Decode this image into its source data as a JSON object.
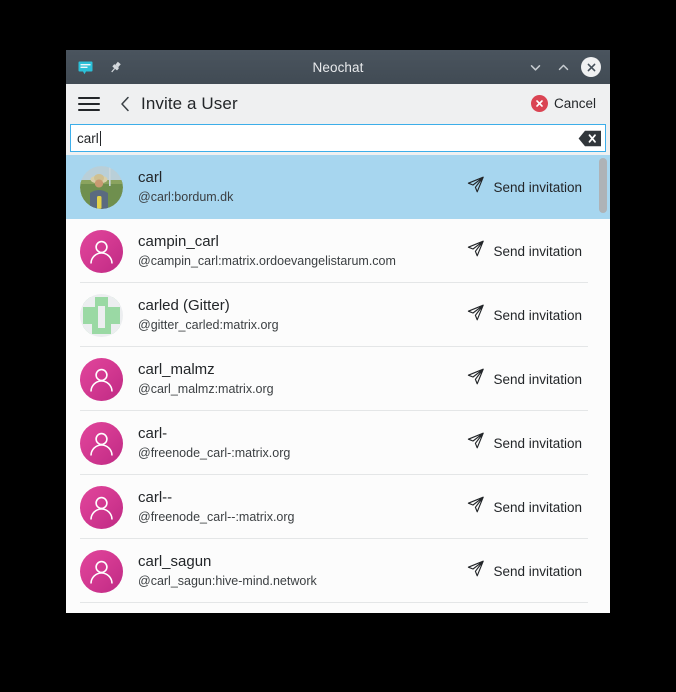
{
  "window": {
    "title": "Neochat",
    "app_icon": "chat-bubble-icon",
    "pin_icon": "pin-icon",
    "minimize_icon": "chevron-down-icon",
    "maximize_icon": "chevron-up-icon",
    "close_icon": "close-icon",
    "accent_color": "#3daee9",
    "titlebar_color": "#45505a"
  },
  "header": {
    "menu_icon": "hamburger-menu-icon",
    "back_icon": "chevron-left-icon",
    "title": "Invite a User",
    "cancel_label": "Cancel",
    "cancel_icon": "cancel-circle-icon",
    "cancel_color": "#da4453"
  },
  "search": {
    "value": "carl",
    "placeholder": "",
    "clear_icon": "clear-text-icon"
  },
  "list": {
    "invite_icon": "send-paper-plane-icon",
    "invite_label": "Send invitation",
    "selected_color": "#a7d6ef",
    "users": [
      {
        "name": "carl",
        "id": "@carl:bordum.dk",
        "avatar_type": "photo",
        "selected": true
      },
      {
        "name": "campin_carl",
        "id": "@campin_carl:matrix.ordoevangelistarum.com",
        "avatar_type": "pink-person",
        "selected": false
      },
      {
        "name": "carled (Gitter)",
        "id": "@gitter_carled:matrix.org",
        "avatar_type": "green-identicon",
        "selected": false
      },
      {
        "name": "carl_malmz",
        "id": "@carl_malmz:matrix.org",
        "avatar_type": "pink-person",
        "selected": false
      },
      {
        "name": "carl-",
        "id": "@freenode_carl-:matrix.org",
        "avatar_type": "pink-person",
        "selected": false
      },
      {
        "name": "carl--",
        "id": "@freenode_carl--:matrix.org",
        "avatar_type": "pink-person",
        "selected": false
      },
      {
        "name": "carl_sagun",
        "id": "@carl_sagun:hive-mind.network",
        "avatar_type": "pink-person",
        "selected": false
      }
    ]
  }
}
